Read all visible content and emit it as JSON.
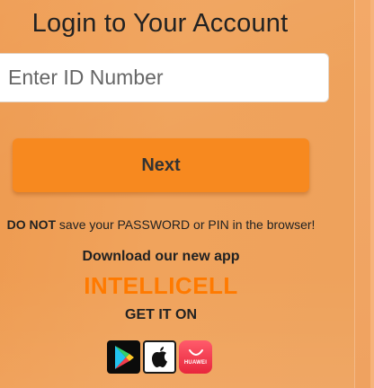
{
  "title": "Login to Your Account",
  "id_input": {
    "placeholder": "Enter ID Number",
    "value": ""
  },
  "next_button": {
    "label": "Next"
  },
  "warning": {
    "emphasis": "DO NOT",
    "text": " save your PASSWORD or PIN in the browser!"
  },
  "download": {
    "heading": "Download our new app",
    "brand": "INTELLICELL",
    "get_it_on": "GET IT ON"
  },
  "stores": [
    {
      "name": "Google Play",
      "icon": "google-play-icon"
    },
    {
      "name": "App Store",
      "icon": "apple-icon"
    },
    {
      "name": "Huawei AppGallery",
      "icon": "huawei-appgallery-icon",
      "label": "HUAWEI"
    }
  ],
  "colors": {
    "panel_bg": "#f0a15a",
    "button_bg": "#f7891f",
    "brand": "#ff7a00",
    "text": "#222222"
  }
}
